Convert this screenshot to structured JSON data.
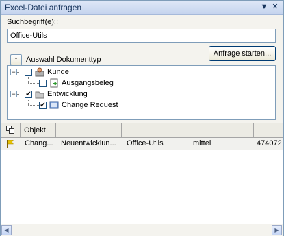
{
  "window": {
    "title": "Excel-Datei anfragen"
  },
  "search": {
    "label": "Suchbegriff(e)::",
    "value": "Office-Utils"
  },
  "actions": {
    "submit_label": "Anfrage starten...",
    "sort_label": "Auswahl Dokumenttyp"
  },
  "tree": [
    {
      "label": "Kunde",
      "checked": false,
      "expanded": true,
      "icon": "customer-icon"
    },
    {
      "label": "Ausgangsbeleg",
      "checked": false,
      "icon": "document-arrow-icon"
    },
    {
      "label": "Entwicklung",
      "checked": true,
      "expanded": true,
      "icon": "folder-icon"
    },
    {
      "label": "Change Request",
      "checked": true,
      "icon": "change-request-icon"
    }
  ],
  "table": {
    "columns": [
      "",
      "Objekt",
      "",
      "",
      "",
      ""
    ],
    "rows": [
      [
        "Chang...",
        "Neuentwicklun...",
        "Office-Utils",
        "mittel",
        "474072"
      ]
    ]
  },
  "colors": {
    "accent": "#17345c",
    "border": "#7f9db9",
    "flag": "#e6c200"
  }
}
